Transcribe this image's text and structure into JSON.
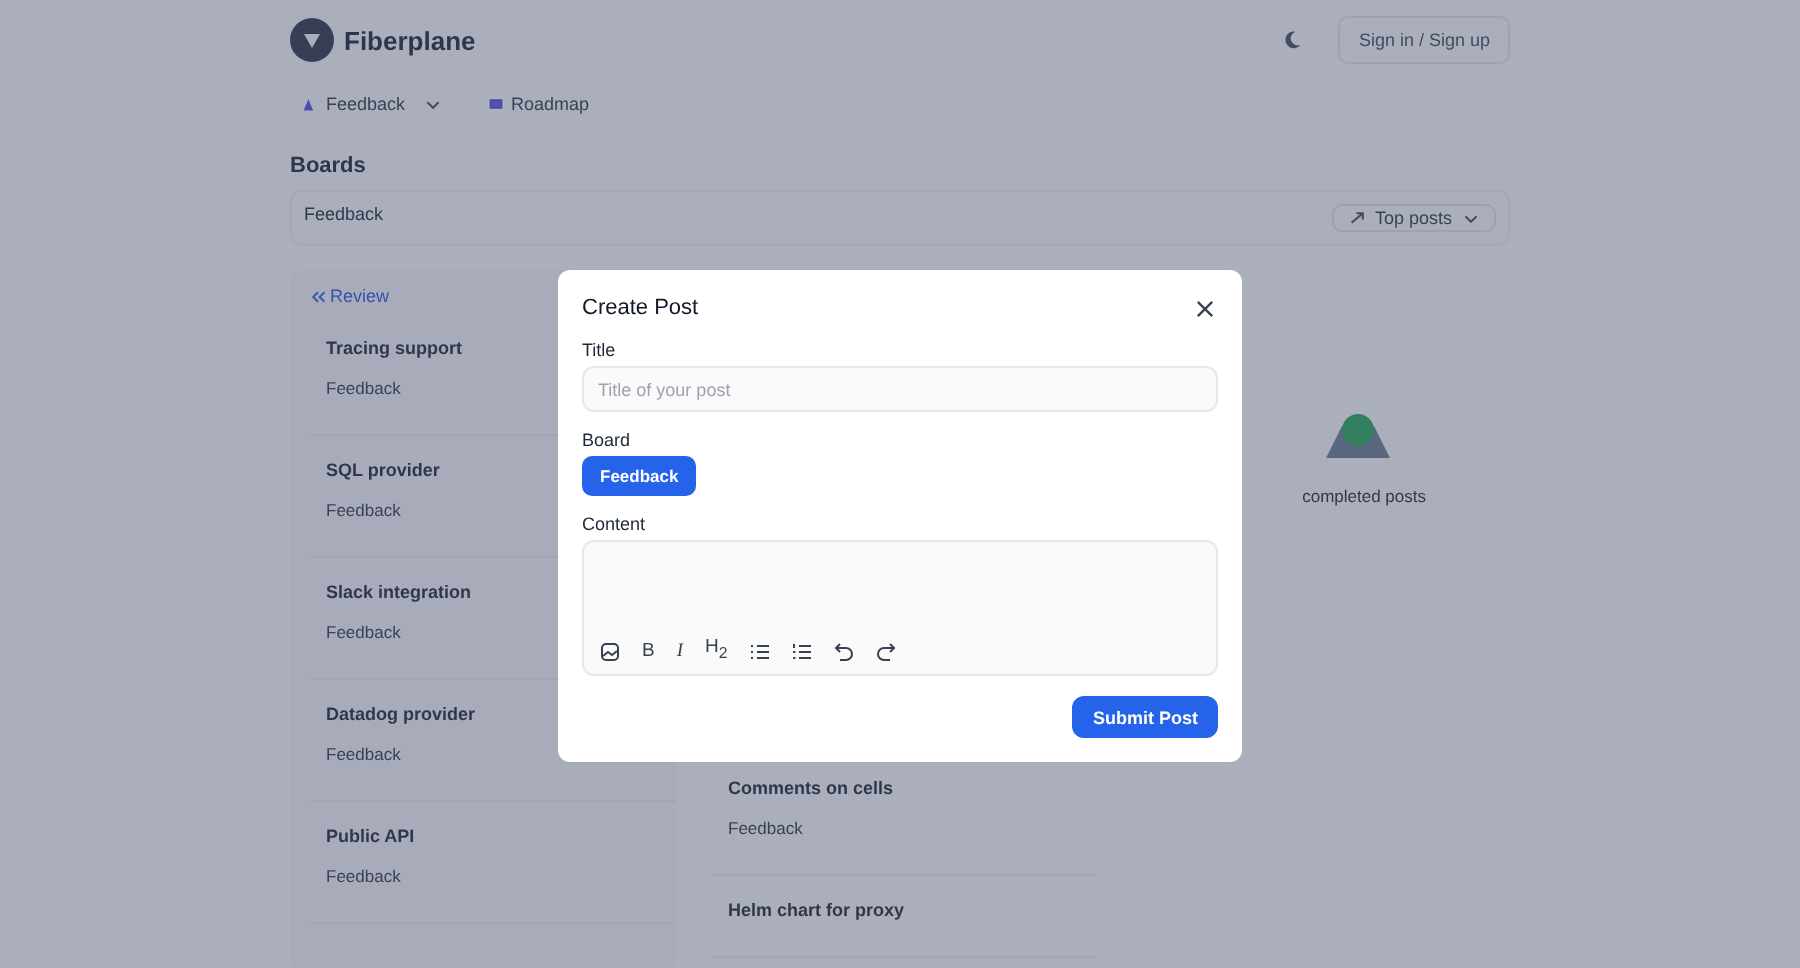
{
  "header": {
    "brand": "Fiberplane",
    "auth_button": "Sign in / Sign up"
  },
  "nav": [
    {
      "label": "Feedback",
      "kind": "dropdown"
    },
    {
      "label": "Roadmap",
      "kind": "link"
    }
  ],
  "boards": {
    "heading": "Boards",
    "board_select": "Feedback",
    "sort_select": "Top posts"
  },
  "columns": [
    {
      "heading": "Review",
      "posts": [
        {
          "title": "Tracing support",
          "board": "Feedback"
        },
        {
          "title": "SQL provider",
          "board": "Feedback"
        },
        {
          "title": "Slack integration",
          "board": "Feedback"
        },
        {
          "title": "Datadog provider",
          "board": "Feedback"
        },
        {
          "title": "Public API",
          "board": "Feedback"
        }
      ]
    },
    {
      "posts": [
        {
          "title": "Comments on cells",
          "board": "Feedback"
        },
        {
          "title": "Helm chart for proxy"
        }
      ]
    },
    {
      "empty_text": "completed posts"
    }
  ],
  "modal": {
    "title": "Create Post",
    "title_label": "Title",
    "title_placeholder": "Title of your post",
    "board_label": "Board",
    "boards": [
      {
        "label": "Feedback",
        "selected": true
      }
    ],
    "content_label": "Content",
    "toolbar": [
      {
        "kind": "image"
      },
      {
        "kind": "text",
        "label": "B"
      },
      {
        "kind": "italic",
        "label": "I"
      },
      {
        "kind": "text",
        "label": "H$_{2}$"
      },
      {
        "kind": "bullet-list"
      },
      {
        "kind": "ordered-list"
      },
      {
        "kind": "undo"
      },
      {
        "kind": "redo"
      }
    ],
    "submit": "Submit Post"
  }
}
